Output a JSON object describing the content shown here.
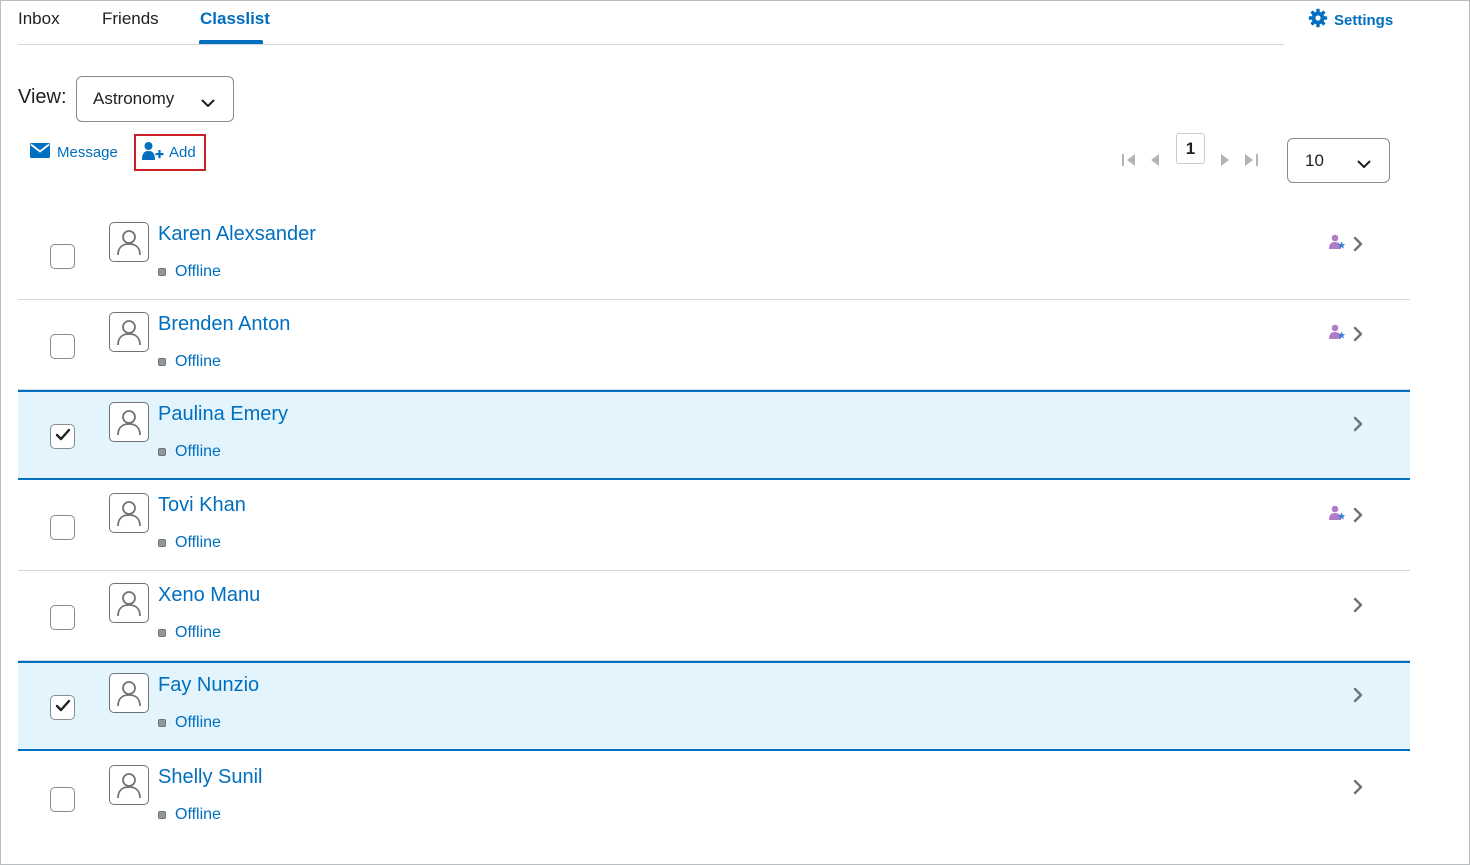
{
  "tabs": [
    {
      "label": "Inbox"
    },
    {
      "label": "Friends"
    },
    {
      "label": "Classlist"
    }
  ],
  "settings": {
    "label": "Settings",
    "icon": "gear-icon"
  },
  "view": {
    "label": "View:",
    "selected": "Astronomy"
  },
  "actions": {
    "message_label": "Message",
    "add_label": "Add"
  },
  "pager": {
    "current_page": "1",
    "per_page": "10"
  },
  "colors": {
    "link": "#006fbf",
    "selected_bg": "#e3f4fc",
    "highlight_border": "#cd2026"
  },
  "people": [
    {
      "name": "Karen Alexsander",
      "status": "Offline",
      "checked": false,
      "role_icon": true
    },
    {
      "name": "Brenden Anton",
      "status": "Offline",
      "checked": false,
      "role_icon": true
    },
    {
      "name": "Paulina Emery",
      "status": "Offline",
      "checked": true,
      "role_icon": false
    },
    {
      "name": "Tovi Khan",
      "status": "Offline",
      "checked": false,
      "role_icon": true
    },
    {
      "name": "Xeno Manu",
      "status": "Offline",
      "checked": false,
      "role_icon": false
    },
    {
      "name": "Fay Nunzio",
      "status": "Offline",
      "checked": true,
      "role_icon": false
    },
    {
      "name": "Shelly Sunil",
      "status": "Offline",
      "checked": false,
      "role_icon": false
    }
  ]
}
